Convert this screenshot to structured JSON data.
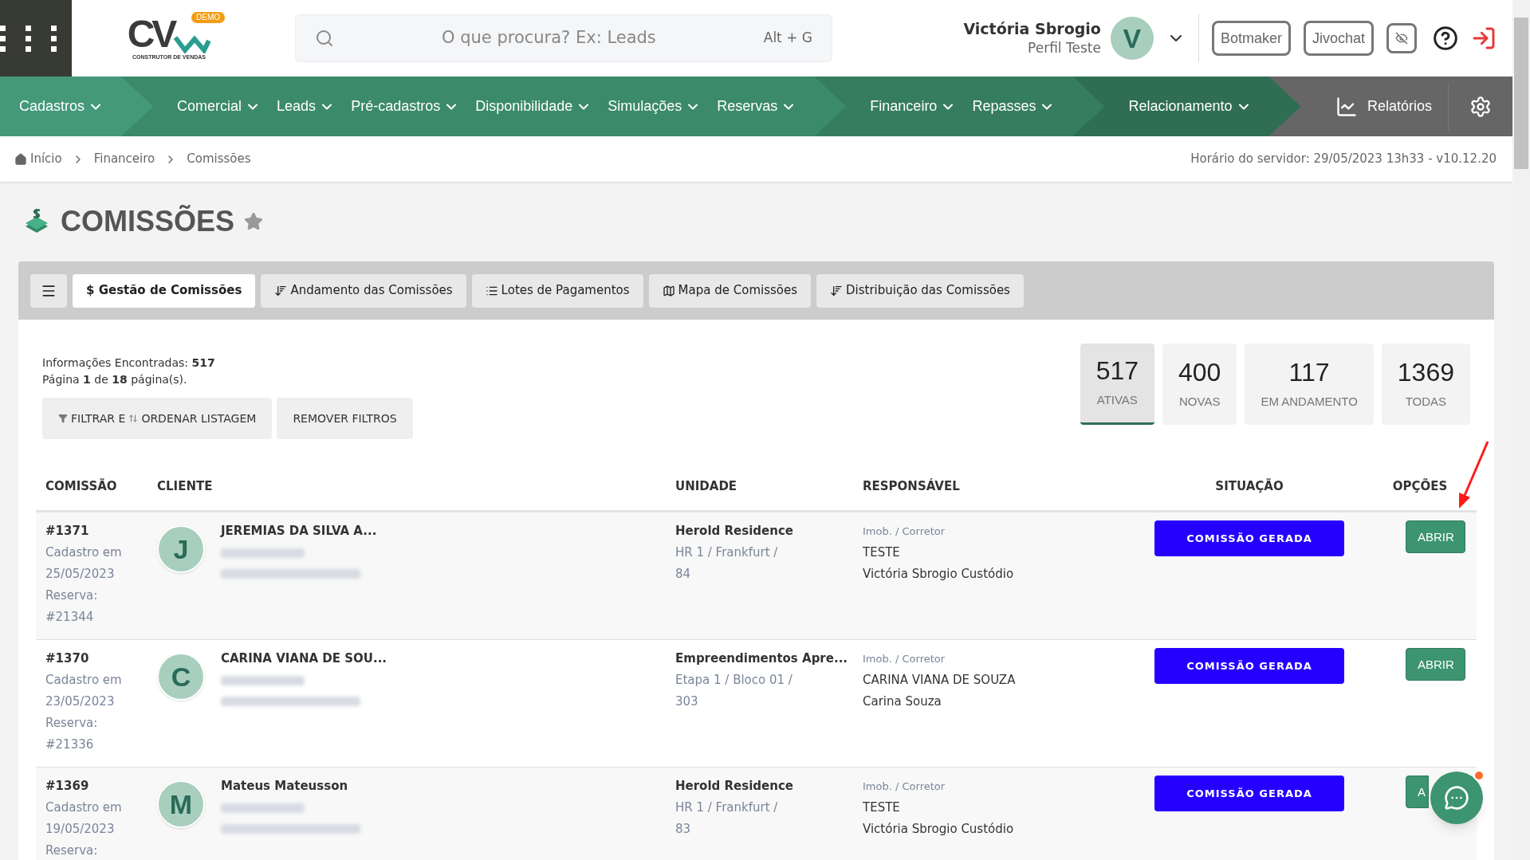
{
  "header": {
    "search": {
      "placeholder": "O que procura? Ex: Leads",
      "shortcut": "Alt + G"
    },
    "logo": {
      "text": "CV",
      "badge": "DEMO",
      "tagline": "CONSTRUTOR DE VENDAS"
    },
    "user": {
      "name": "Victória Sbrogio",
      "profile": "Perfil Teste",
      "initial": "V"
    },
    "buttons": [
      "Botmaker",
      "Jivochat"
    ]
  },
  "nav": {
    "groups": [
      {
        "items": [
          "Cadastros"
        ]
      },
      {
        "items": [
          "Comercial",
          "Leads",
          "Pré-cadastros",
          "Disponibilidade",
          "Simulações",
          "Reservas"
        ]
      },
      {
        "items": [
          "Financeiro",
          "Repasses"
        ]
      },
      {
        "items": [
          "Relacionamento"
        ]
      }
    ],
    "reports": "Relatórios"
  },
  "breadcrumb": [
    "Início",
    "Financeiro",
    "Comissões"
  ],
  "server_time": "Horário do servidor: 29/05/2023 13h33 - v10.12.20",
  "page_title": "COMISSÕES",
  "tabs": [
    {
      "label": "$ Gestão de Comissões",
      "kind": "plain",
      "selected": true
    },
    {
      "label": "Andamento das Comissões",
      "kind": "sort",
      "selected": false
    },
    {
      "label": "Lotes de Pagamentos",
      "kind": "list",
      "selected": false
    },
    {
      "label": "Mapa de Comissões",
      "kind": "map",
      "selected": false
    },
    {
      "label": "Distribuição das Comissões",
      "kind": "sort",
      "selected": false
    }
  ],
  "summary": {
    "found": "Informações Encontradas: **517**",
    "page": "Página **1** de **18** página(s)."
  },
  "filter_buttons": [
    "FILTRAR E",
    "ORDENAR LISTAGEM",
    "REMOVER FILTROS"
  ],
  "stats": [
    {
      "value": "517",
      "label": "ATIVAS",
      "selected": true
    },
    {
      "value": "400",
      "label": "NOVAS",
      "selected": false
    },
    {
      "value": "117",
      "label": "EM ANDAMENTO",
      "selected": false
    },
    {
      "value": "1369",
      "label": "TODAS",
      "selected": false
    }
  ],
  "table": {
    "columns": [
      "COMISSÃO",
      "CLIENTE",
      "UNIDADE",
      "RESPONSÁVEL",
      "SITUAÇÃO",
      "OPÇÕES"
    ],
    "rows": [
      {
        "id": "#1371",
        "cadastro": "Cadastro em",
        "date": "25/05/2023",
        "reserva_label": "Reserva:",
        "reserva": "#21344",
        "initial": "J",
        "client": "JEREMIAS DA SILVA A...",
        "unit": "Herold Residence",
        "unit_detail": "HR 1 / Frankfurt /",
        "unit_number": "84",
        "role": "Imob. / Corretor",
        "imob": "TESTE",
        "corretor": "Victória Sbrogio Custódio",
        "status": "COMISSÃO GERADA",
        "action": "ABRIR"
      },
      {
        "id": "#1370",
        "cadastro": "Cadastro em",
        "date": "23/05/2023",
        "reserva_label": "Reserva:",
        "reserva": "#21336",
        "initial": "C",
        "client": "CARINA VIANA DE SOU...",
        "unit": "Empreendimentos Apre...",
        "unit_detail": "Etapa 1 / Bloco 01 /",
        "unit_number": "303",
        "role": "Imob. / Corretor",
        "imob": "CARINA VIANA DE SOUZA",
        "corretor": "Carina Souza",
        "status": "COMISSÃO GERADA",
        "action": "ABRIR"
      },
      {
        "id": "#1369",
        "cadastro": "Cadastro em",
        "date": "19/05/2023",
        "reserva_label": "Reserva:",
        "initial": "M",
        "client": "Mateus Mateusson",
        "unit": "Herold Residence",
        "unit_detail": "HR 1 / Frankfurt /",
        "unit_number": "83",
        "role": "Imob. / Corretor",
        "imob": "TESTE",
        "corretor": "Victória Sbrogio Custódio",
        "status": "COMISSÃO GERADA",
        "action": "A"
      }
    ]
  }
}
